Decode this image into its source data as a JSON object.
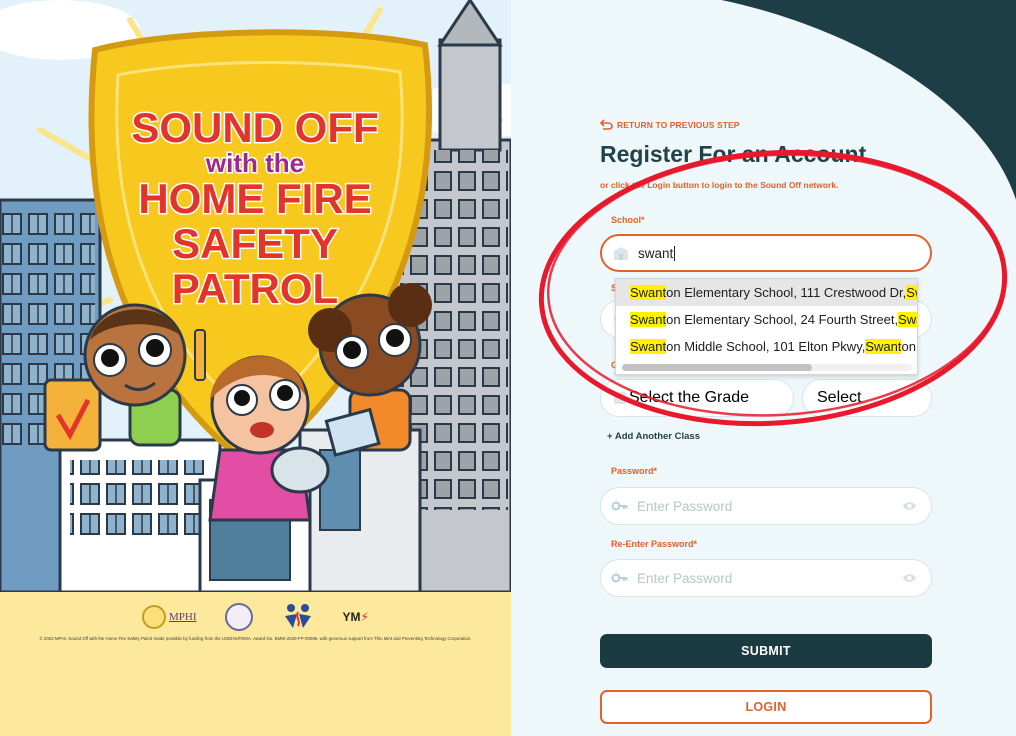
{
  "poster": {
    "headline_line1": "SOUND OFF",
    "headline_line2": "with the",
    "headline_line3": "HOME FIRE",
    "headline_line4": "SAFETY",
    "headline_line5": "PATROL",
    "footer_logos": [
      {
        "name": "mphi-logo",
        "text": "MPHI"
      },
      {
        "name": "seal-logo",
        "text": ""
      },
      {
        "name": "fire-is-everyones-fight-logo",
        "text": "Fire is Everyone's Fight"
      },
      {
        "name": "ym-logo",
        "text": "YM"
      }
    ],
    "credit": "© 2022 MPHI. Sound Off with the Home Fire Safety Patrol made possible by funding from the USDHS/FEMA, Award No. EMW-2020-FP-00095, with generous support from Thin Mint and Preventing Technology Corporation."
  },
  "form": {
    "back_link": "RETURN TO PREVIOUS STEP",
    "title": "Register For an Account",
    "subtitle": "or click the Login button to login to the Sound Off network.",
    "school_label": "School*",
    "school_value": "swant",
    "grade_placeholder": "Select the Grade",
    "class_placeholder": "Select",
    "add_class": "+ Add Another Class",
    "password_label": "Password*",
    "password_placeholder": "Enter Password",
    "reenter_label": "Re-Enter Password*",
    "reenter_placeholder": "Enter Password",
    "submit": "SUBMIT",
    "login": "LOGIN"
  },
  "autocomplete": {
    "items": [
      {
        "match": "Swant",
        "rest": "on Elementary School, 111 Crestwood Dr, ",
        "match2": "Sw"
      },
      {
        "match": "Swant",
        "rest": "on Elementary School, 24 Fourth Street, ",
        "match2": "Swa"
      },
      {
        "match": "Swant",
        "rest": "on Middle School, 101 Elton Pkwy, ",
        "match2": "Swant",
        "tail": "on"
      }
    ]
  },
  "colors": {
    "accent_orange": "#e0622d",
    "dark_teal": "#1c3a42",
    "panel_bg": "#eef7f9",
    "highlight": "#fff200",
    "annotation_red": "#e8192c",
    "shield_yellow": "#f7c81e",
    "headline_red": "#e2342a"
  }
}
